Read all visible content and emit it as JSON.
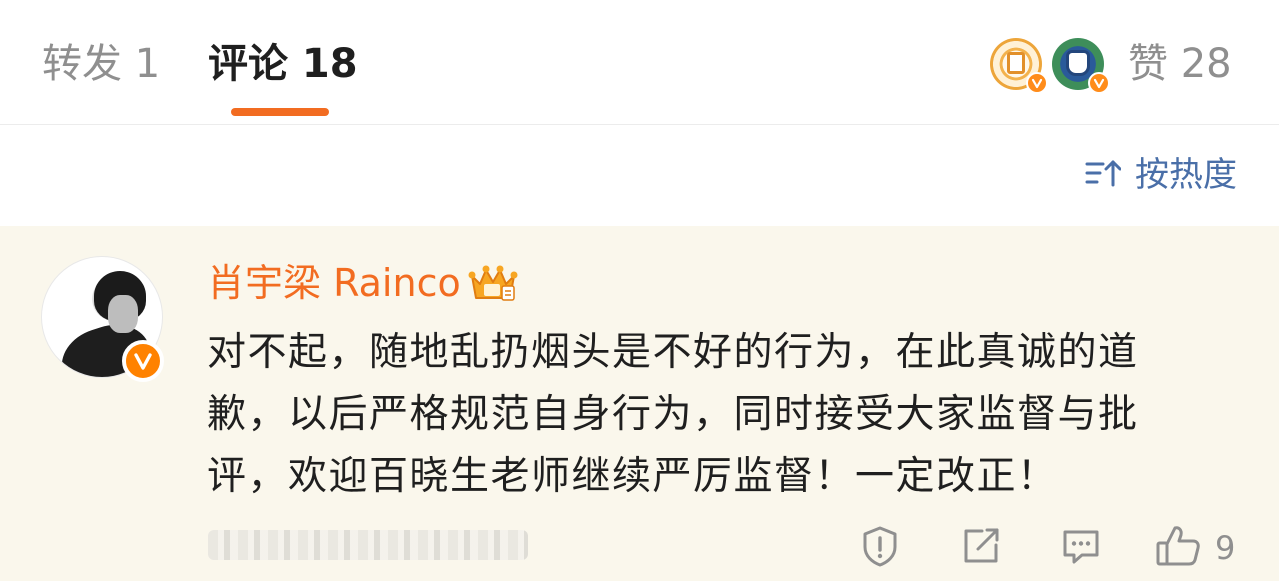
{
  "tabs": {
    "repost_label": "转发 1",
    "comments_label": "评论 18"
  },
  "likes": {
    "label": "赞 28"
  },
  "sort": {
    "label": "按热度"
  },
  "comment": {
    "username": "肖宇梁 Rainco",
    "text": "对不起，随地乱扔烟头是不好的行为，在此真诚的道歉，以后严格规范自身行为，同时接受大家监督与批评，欢迎百晓生老师继续严厉监督！一定改正！",
    "like_count": "9"
  },
  "colors": {
    "accent": "#f26c21",
    "link_blue": "#4a6fa8",
    "comment_bg": "#faf7ec",
    "verified": "#ff8200"
  },
  "icons": {
    "sort": "sort-icon",
    "report": "report-icon",
    "repost": "repost-icon",
    "reply": "reply-icon",
    "like": "thumb-up-icon",
    "verified": "verified-v-icon",
    "crown": "crown-badge-icon"
  }
}
